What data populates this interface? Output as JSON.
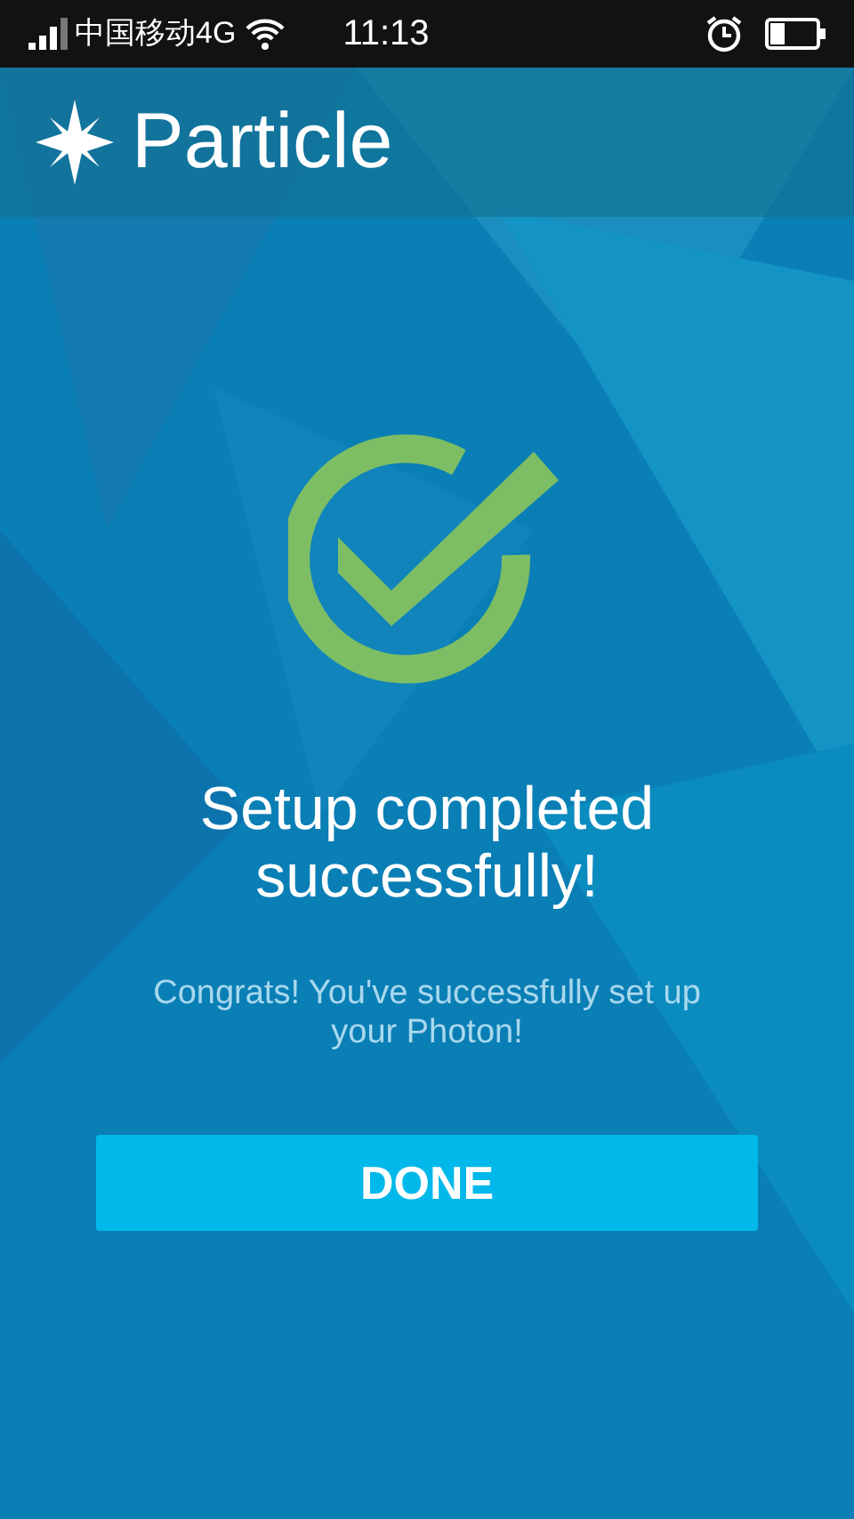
{
  "status_bar": {
    "carrier": "中国移动4G",
    "time": "11:13"
  },
  "header": {
    "logo_text": "Particle"
  },
  "title": "Setup completed successfully!",
  "message": "Congrats! You've successfully set up your Photon!",
  "button": {
    "label": "DONE"
  }
}
